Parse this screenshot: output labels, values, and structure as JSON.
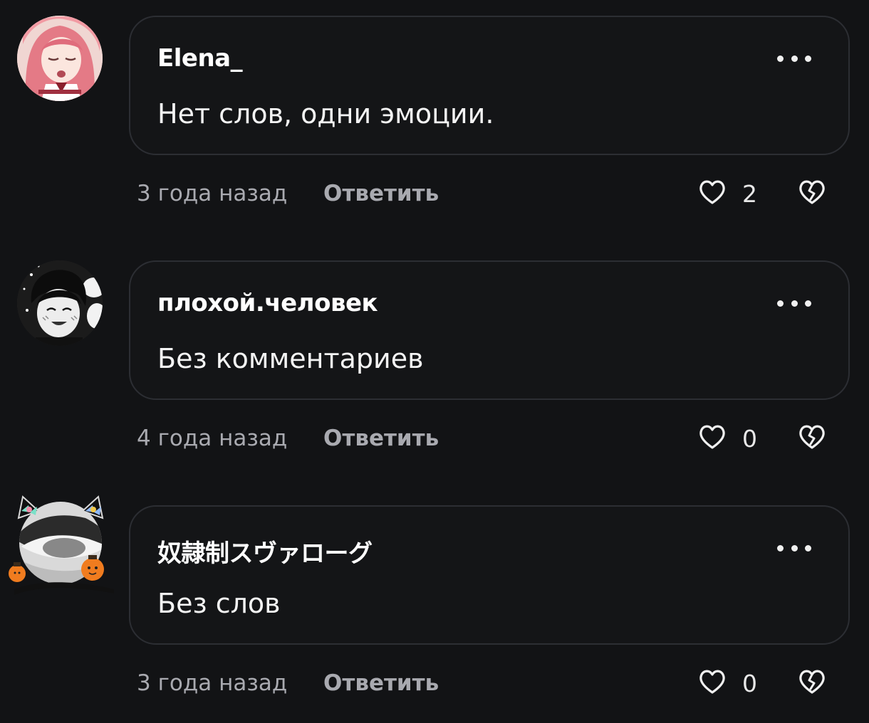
{
  "comments": [
    {
      "author": "Elena_",
      "text": "Нет слов, одни эмоции.",
      "time": "3 года назад",
      "reply_label": "Ответить",
      "likes": "2"
    },
    {
      "author": "плохой.человек",
      "text": "Без комментариев",
      "time": "4 года назад",
      "reply_label": "Ответить",
      "likes": "0"
    },
    {
      "author": "奴隷制スヴァローグ",
      "text": "Без слов",
      "time": "3 года назад",
      "reply_label": "Ответить",
      "likes": "0"
    }
  ],
  "icons": {
    "more": "more-dots-icon",
    "like": "heart-icon",
    "dislike": "broken-heart-icon"
  },
  "colors": {
    "background": "#121315",
    "bubble_border": "#2c2e33",
    "muted_text": "#a9aab0"
  }
}
